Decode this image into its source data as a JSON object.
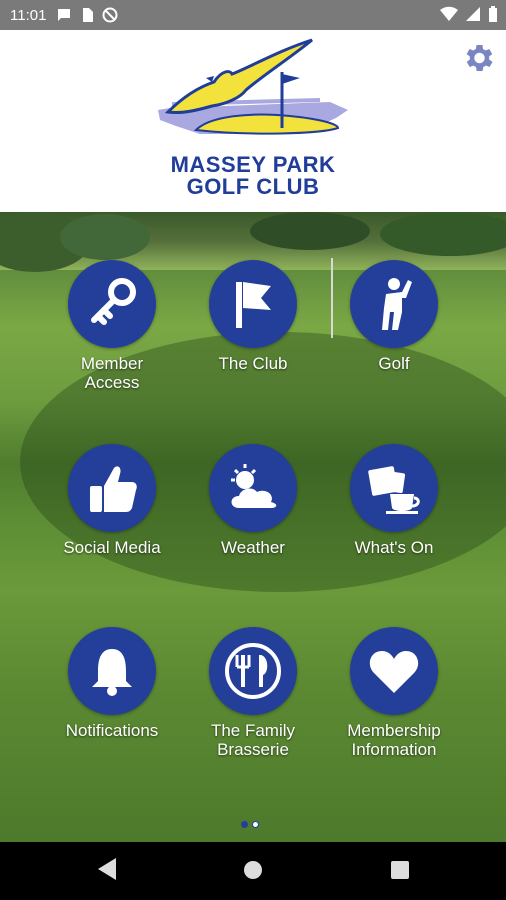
{
  "status_bar": {
    "time": "11:01"
  },
  "header": {
    "logo_line1": "MASSEY PARK",
    "logo_line2": "GOLF CLUB"
  },
  "tiles": [
    {
      "label": "Member\nAccess"
    },
    {
      "label": "The Club"
    },
    {
      "label": "Golf"
    },
    {
      "label": "Social Media"
    },
    {
      "label": "Weather"
    },
    {
      "label": "What's On"
    },
    {
      "label": "Notifications"
    },
    {
      "label": "The Family\nBrasserie"
    },
    {
      "label": "Membership\nInformation"
    }
  ],
  "colors": {
    "brand_blue": "#233f99",
    "logo_yellow": "#f3e23b",
    "logo_lavender": "#a9a8e0"
  },
  "icons": [
    "key-icon",
    "flag-icon",
    "golfer-icon",
    "thumbs-up-icon",
    "weather-icon",
    "coffee-calendar-icon",
    "bell-icon",
    "utensils-icon",
    "heart-icon"
  ]
}
